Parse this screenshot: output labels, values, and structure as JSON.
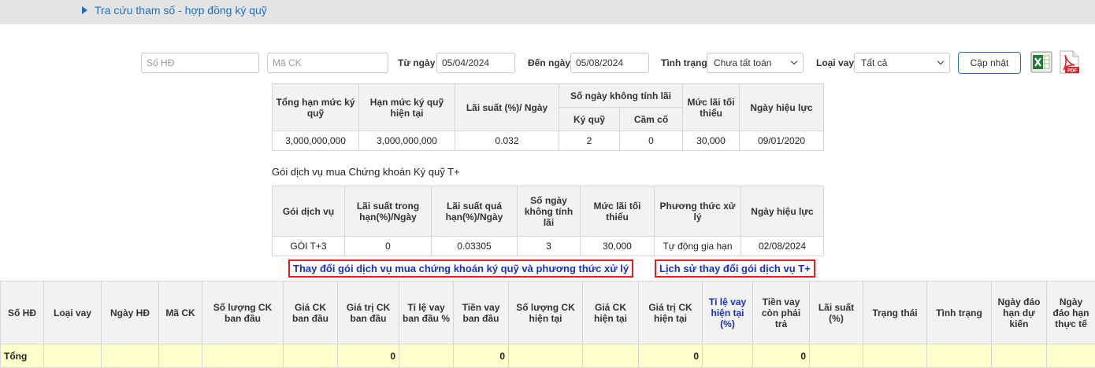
{
  "header": {
    "title": "Tra cứu tham số - hợp đồng ký quỹ"
  },
  "filters": {
    "contract_placeholder": "Số HĐ",
    "stock_placeholder": "Mã CK",
    "from_label": "Từ ngày",
    "from_value": "05/04/2024",
    "to_label": "Đến ngày",
    "to_value": "05/08/2024",
    "status_label": "Tình trạng",
    "status_value": "Chưa tất toán",
    "loan_label": "Loại vay",
    "loan_value": "Tất cả",
    "update_button": "Cập nhật",
    "icons": [
      "excel-icon",
      "pdf-icon"
    ]
  },
  "margin_table": {
    "headers": {
      "total_limit": "Tổng hạn mức ký quỹ",
      "current_limit": "Hạn mức ký quỹ hiện tại",
      "rate": "Lãi suất (%)/ Ngày",
      "no_interest_days": "Số ngày không tính lãi",
      "margin": "Ký quỹ",
      "pledge": "Cầm cố",
      "min_interest": "Mức lãi tối thiểu",
      "effective_date": "Ngày hiệu lực"
    },
    "row": {
      "total_limit": "3,000,000,000",
      "current_limit": "3,000,000,000",
      "rate": "0.032",
      "margin": "2",
      "pledge": "0",
      "min_interest": "30,000",
      "effective_date": "09/01/2020"
    }
  },
  "package_caption": "Gói dịch vụ mua Chứng khoán Ký quỹ T+",
  "package_table": {
    "headers": {
      "package": "Gói dịch vụ",
      "in_term_rate": "Lãi suất trong hạn(%)/Ngày",
      "overdue_rate": "Lãi suất quá hạn(%)/Ngày",
      "no_interest_days": "Số ngày không tính lãi",
      "min_interest": "Mức lãi tối thiểu",
      "method": "Phương thức xử lý",
      "effective_date": "Ngày hiệu lực"
    },
    "row": {
      "package": "GÓI T+3",
      "in_term_rate": "0",
      "overdue_rate": "0.03305",
      "no_interest_days": "3",
      "min_interest": "30,000",
      "method": "Tự động gia hạn",
      "effective_date": "02/08/2024"
    }
  },
  "links": {
    "change_package": "Thay đổi gói dịch vụ mua chứng khoán ký quỹ và phương thức xử lý",
    "history": "Lịch sử thay đổi gói dịch vụ T+"
  },
  "main_table": {
    "headers": [
      "Số HĐ",
      "Loại vay",
      "Ngày HĐ",
      "Mã CK",
      "Số lượng CK ban đầu",
      "Giá CK ban đầu",
      "Giá trị CK ban đầu",
      "Tỉ lệ vay ban đầu %",
      "Tiền vay ban đầu",
      "Số lượng CK hiện tại",
      "Giá CK hiện tại",
      "Giá trị CK hiện tại",
      "Tỉ lệ vay hiện tại (%)",
      "Tiền vay còn phải trả",
      "Lãi suất (%)",
      "Trạng thái",
      "Tình trạng",
      "Ngày đáo hạn dự kiến",
      "Ngày đáo hạn thực tế"
    ],
    "total_row": {
      "label": "Tổng",
      "initial_value": "0",
      "initial_loan": "0",
      "current_value": "0",
      "remaining_loan": "0"
    }
  }
}
